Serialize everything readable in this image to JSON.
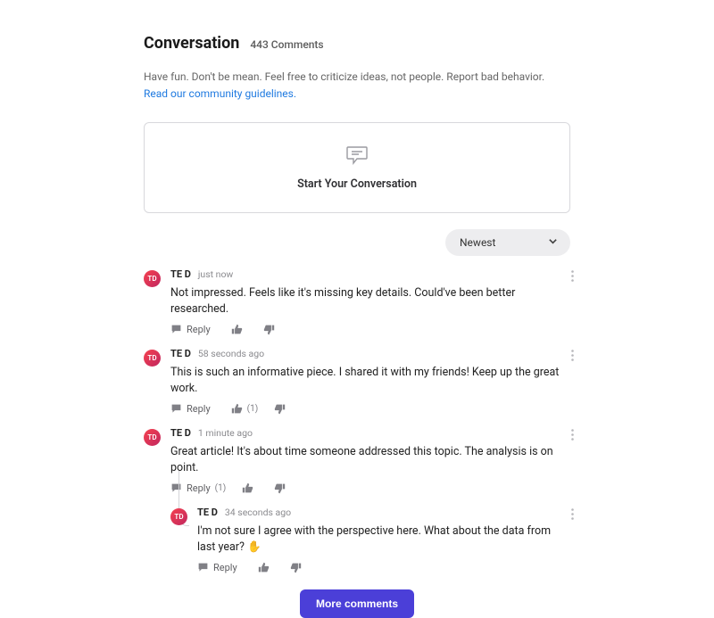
{
  "header": {
    "title": "Conversation",
    "count": "443 Comments"
  },
  "guidelines": {
    "text": "Have fun. Don't be mean. Feel free to criticize ideas, not people. Report bad behavior. ",
    "link": "Read our community guidelines."
  },
  "start": {
    "label": "Start Your Conversation"
  },
  "sort": {
    "selected": "Newest"
  },
  "comments": [
    {
      "avatar": "TD",
      "user": "TE D",
      "time": "just now",
      "body": "Not impressed. Feels like it's missing key details. Could've been better researched.",
      "reply_label": "Reply",
      "reply_count": "",
      "like_count": ""
    },
    {
      "avatar": "TD",
      "user": "TE D",
      "time": "58 seconds ago",
      "body": "This is such an informative piece. I shared it with my friends! Keep up the great work.",
      "reply_label": "Reply",
      "reply_count": "",
      "like_count": "(1)"
    },
    {
      "avatar": "TD",
      "user": "TE D",
      "time": "1 minute ago",
      "body": "Great article! It's about time someone addressed this topic. The analysis is on point.",
      "reply_label": "Reply",
      "reply_count": "(1)",
      "like_count": "",
      "children": [
        {
          "avatar": "TD",
          "user": "TE D",
          "time": "34 seconds ago",
          "body": "I'm not sure I agree with the perspective here. What about the data from last year? ✋",
          "reply_label": "Reply",
          "reply_count": "",
          "like_count": ""
        }
      ]
    }
  ],
  "more": {
    "label": "More comments"
  }
}
